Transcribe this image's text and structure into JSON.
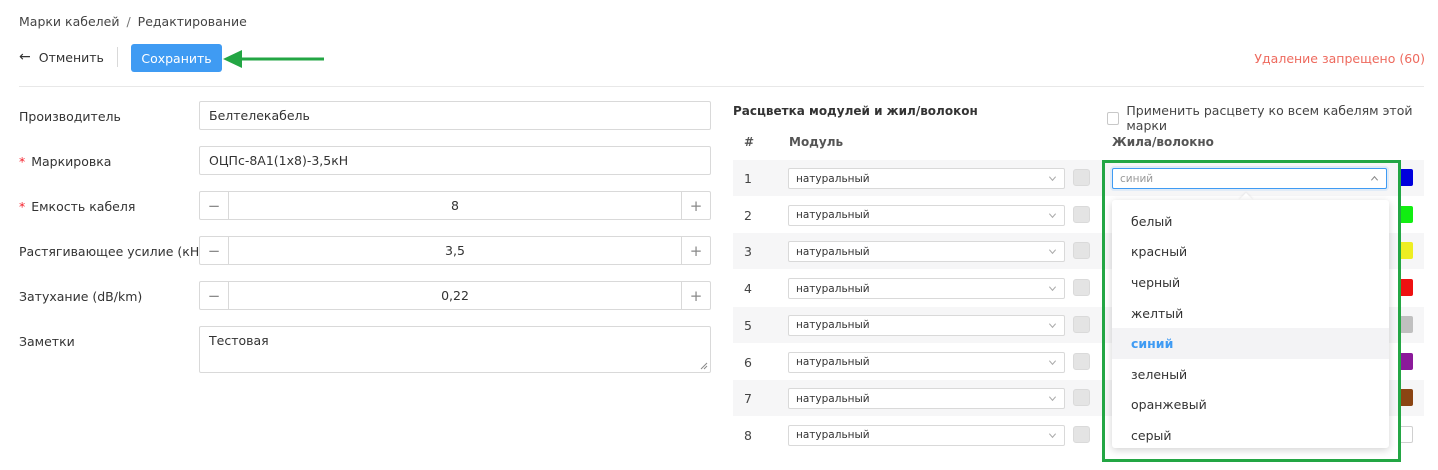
{
  "breadcrumb": {
    "parent": "Марки кабелей",
    "separator": "/",
    "current": "Редактирование"
  },
  "toolbar": {
    "cancel_label": "Отменить",
    "cancel_icon": "arrow-left-icon",
    "save_label": "Сохранить",
    "delete_notice": "Удаление запрещено (60)"
  },
  "form": {
    "manufacturer": {
      "label": "Производитель",
      "value": "Белтелекабель"
    },
    "marking": {
      "required_mark": "*",
      "label": "Маркировка",
      "value": "ОЦПс-8А1(1x8)-3,5кН"
    },
    "capacity": {
      "required_mark": "*",
      "label": "Емкость кабеля",
      "value": "8",
      "minus": "−",
      "plus": "+"
    },
    "tensile": {
      "label": "Растягивающее усилие (кН)",
      "value": "3,5",
      "minus": "−",
      "plus": "+"
    },
    "attenuation": {
      "label": "Затухание (dB/km)",
      "value": "0,22",
      "minus": "−",
      "plus": "+"
    },
    "notes": {
      "label": "Заметки",
      "value": "Тестовая"
    }
  },
  "coloring": {
    "title": "Расцветка модулей и жил/волокон",
    "apply_all_label": "Применить расцвету ко всем кабелям этой марки",
    "columns": {
      "num": "#",
      "module": "Модуль",
      "core": "Жила/волокно"
    },
    "rows": [
      {
        "num": "1",
        "module": "натуральный",
        "core_color": "#0000dd"
      },
      {
        "num": "2",
        "module": "натуральный",
        "core_color": "#11ee11"
      },
      {
        "num": "3",
        "module": "натуральный",
        "core_color": "#eeee22"
      },
      {
        "num": "4",
        "module": "натуральный",
        "core_color": "#ee1111"
      },
      {
        "num": "5",
        "module": "натуральный",
        "core_color": "#c0c0c0"
      },
      {
        "num": "6",
        "module": "натуральный",
        "core_color": "#8b1a9a"
      },
      {
        "num": "7",
        "module": "натуральный",
        "core_color": "#8b4513"
      },
      {
        "num": "8",
        "module": "натуральный",
        "core_color": "#ffffff"
      }
    ],
    "core_select_value": "синий",
    "dropdown_options": [
      "белый",
      "красный",
      "черный",
      "желтый",
      "синий",
      "зеленый",
      "оранжевый",
      "серый"
    ],
    "dropdown_selected": "синий"
  },
  "colors": {
    "accent": "#3f9bf3",
    "danger": "#ee6a5e",
    "annotation": "#23a644"
  }
}
